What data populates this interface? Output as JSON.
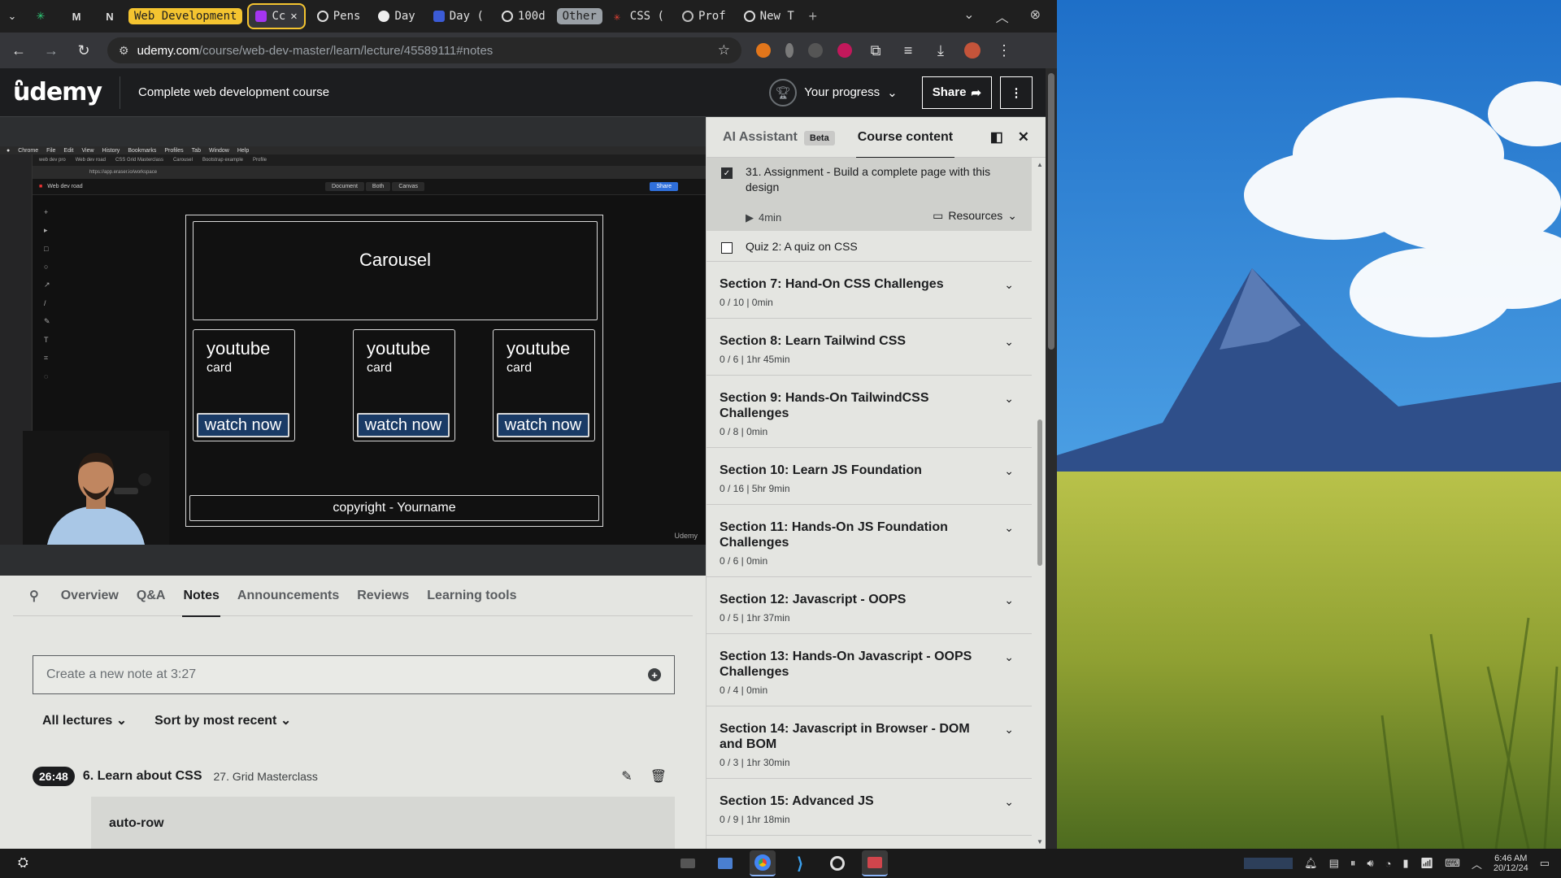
{
  "browser": {
    "tab_groups": [
      {
        "label": "Web Development",
        "color": "#f4c430"
      },
      {
        "label": "Other",
        "color": "#9aa0a6"
      }
    ],
    "tabs": [
      {
        "label": "Cc",
        "active": true
      },
      {
        "label": "Pens"
      },
      {
        "label": "Day"
      },
      {
        "label": "Day ("
      },
      {
        "label": "100d"
      },
      {
        "label": "CSS ("
      },
      {
        "label": "Prof"
      },
      {
        "label": "New T"
      }
    ],
    "url_host": "udemy.com",
    "url_path": "/course/web-dev-master/learn/lecture/45589111#notes"
  },
  "udemy": {
    "logo": "udemy",
    "course_title": "Complete web development course",
    "progress_label": "Your progress",
    "share_label": "Share"
  },
  "video": {
    "carousel": "Carousel",
    "cards": [
      {
        "title": "youtube",
        "sub": "card",
        "button": "watch now"
      },
      {
        "title": "youtube",
        "sub": "card",
        "button": "watch now"
      },
      {
        "title": "youtube",
        "sub": "card",
        "button": "watch now"
      }
    ],
    "footer": "copyright - Yourname",
    "watermark": "Udemy"
  },
  "lecture_tabs": [
    "Overview",
    "Q&A",
    "Notes",
    "Announcements",
    "Reviews",
    "Learning tools"
  ],
  "notes": {
    "input_placeholder": "Create a new note at 3:27",
    "filter_lectures": "All lectures",
    "filter_sort": "Sort by most recent",
    "items": [
      {
        "time": "26:48",
        "section": "6. Learn about CSS",
        "lecture": "27. Grid Masterclass",
        "body": "auto-row"
      }
    ]
  },
  "panel": {
    "tab_ai": "AI Assistant",
    "beta": "Beta",
    "tab_content": "Course content",
    "lessons": [
      {
        "title": "31. Assignment - Build a complete page with this design",
        "duration": "4min",
        "resources": "Resources",
        "checked": true
      },
      {
        "title": "Quiz 2: A quiz on CSS",
        "checked": false
      }
    ],
    "sections": [
      {
        "title": "Section 7: Hand-On CSS Challenges",
        "meta": "0 / 10 | 0min"
      },
      {
        "title": "Section 8: Learn Tailwind CSS",
        "meta": "0 / 6 | 1hr 45min"
      },
      {
        "title": "Section 9: Hands-On TailwindCSS Challenges",
        "meta": "0 / 8 | 0min"
      },
      {
        "title": "Section 10: Learn JS Foundation",
        "meta": "0 / 16 | 5hr 9min"
      },
      {
        "title": "Section 11: Hands-On JS Foundation Challenges",
        "meta": "0 / 6 | 0min"
      },
      {
        "title": "Section 12: Javascript - OOPS",
        "meta": "0 / 5 | 1hr 37min"
      },
      {
        "title": "Section 13: Hands-On Javascript - OOPS Challenges",
        "meta": "0 / 4 | 0min"
      },
      {
        "title": "Section 14: Javascript in Browser - DOM and BOM",
        "meta": "0 / 3 | 1hr 30min"
      },
      {
        "title": "Section 15: Advanced JS",
        "meta": "0 / 9 | 1hr 18min"
      }
    ]
  },
  "taskbar": {
    "time": "6:46 AM",
    "date": "20/12/24"
  },
  "colors": {
    "udemy_dark": "#1c1d1f",
    "panel_bg": "#e4e5e1",
    "group_yellow": "#f4c430"
  }
}
